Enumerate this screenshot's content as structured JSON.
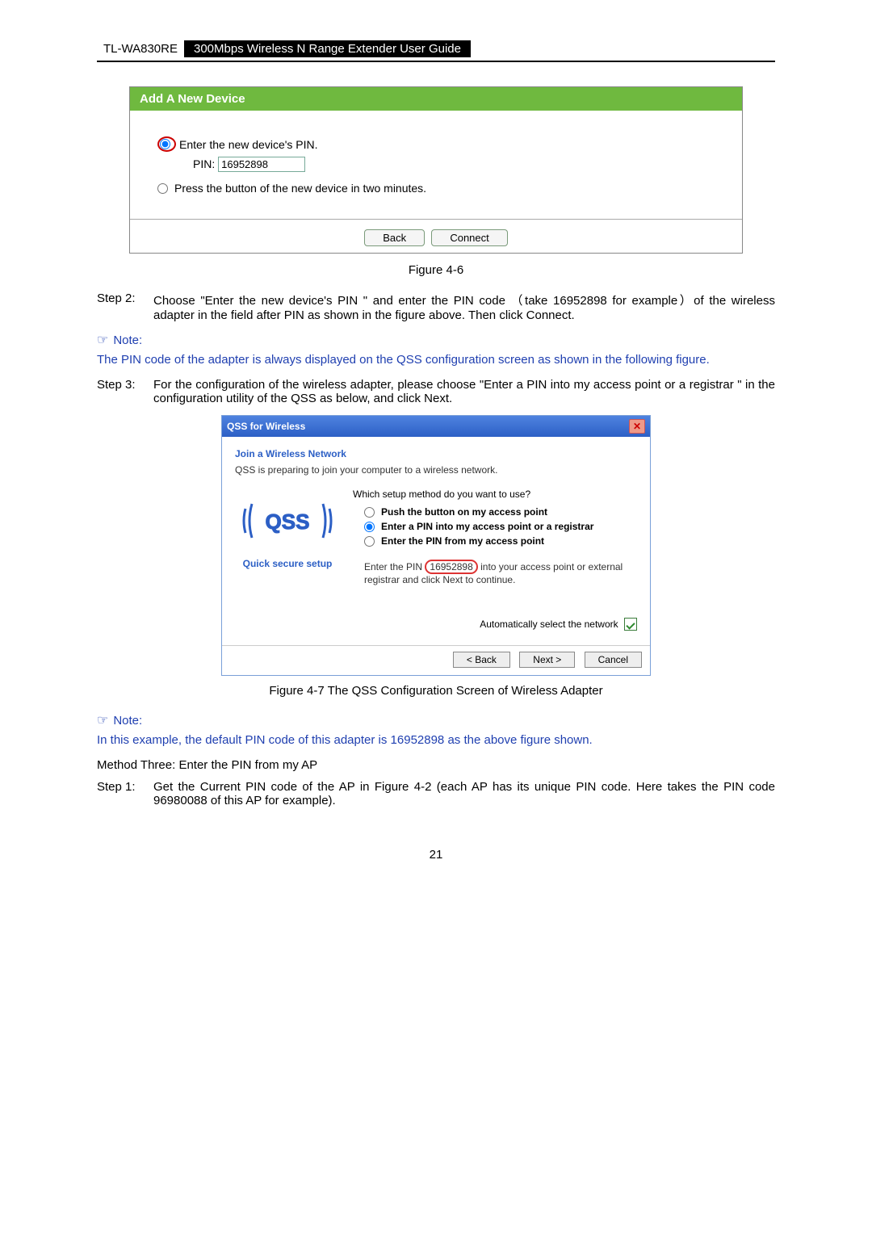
{
  "header": {
    "model": "TL-WA830RE",
    "title": "300Mbps Wireless N Range Extender User Guide"
  },
  "fig46": {
    "panel_title": "Add A New Device",
    "opt_enter_pin": "Enter the new device's PIN.",
    "pin_label": "PIN:",
    "pin_value": "16952898",
    "opt_press_button": "Press the button of the new device in two minutes.",
    "btn_back": "Back",
    "btn_connect": "Connect",
    "caption": "Figure 4-6"
  },
  "step2": {
    "label": "Step 2:",
    "text": "Choose \"Enter the new device's PIN \" and enter the PIN code （take 16952898 for example）of the wireless adapter in the field after PIN as shown in the figure above. Then click Connect."
  },
  "note1": {
    "label": "Note:",
    "text": "The PIN code of the adapter is always displayed on the QSS configuration screen as shown in the following figure."
  },
  "step3": {
    "label": "Step 3:",
    "text": "For the configuration of the wireless adapter, please choose \"Enter a PIN into my access point or a registrar  \" in the configuration utility of the QSS as below, and click Next."
  },
  "wizard": {
    "title": "QSS for Wireless",
    "heading": "Join a Wireless Network",
    "sub": "QSS is preparing to join your computer to a wireless network.",
    "logo_caption": "Quick secure setup",
    "question": "Which setup method do you want to use?",
    "opt_push": "Push the button on my access point",
    "opt_enter_pin": "Enter a PIN into my access point or a registrar",
    "opt_from_ap": "Enter the PIN from my access point",
    "info_prefix": "Enter the PIN",
    "info_pin": "16952898",
    "info_suffix": "into your access point or external registrar and click Next to continue.",
    "auto_label": "Automatically select the network",
    "btn_back": "< Back",
    "btn_next": "Next >",
    "btn_cancel": "Cancel"
  },
  "fig47_caption": "Figure 4-7 The QSS Configuration Screen of Wireless Adapter",
  "note2": {
    "label": "Note:",
    "text": "In this example, the default PIN code of this adapter is 16952898 as the above figure shown."
  },
  "method3": "Method Three:  Enter the PIN from my AP",
  "step1": {
    "label": "Step 1:",
    "text": "Get the Current PIN code of the AP in Figure 4-2 (each AP has its unique PIN code. Here takes the PIN code 96980088 of this AP for example)."
  },
  "page_number": "21"
}
